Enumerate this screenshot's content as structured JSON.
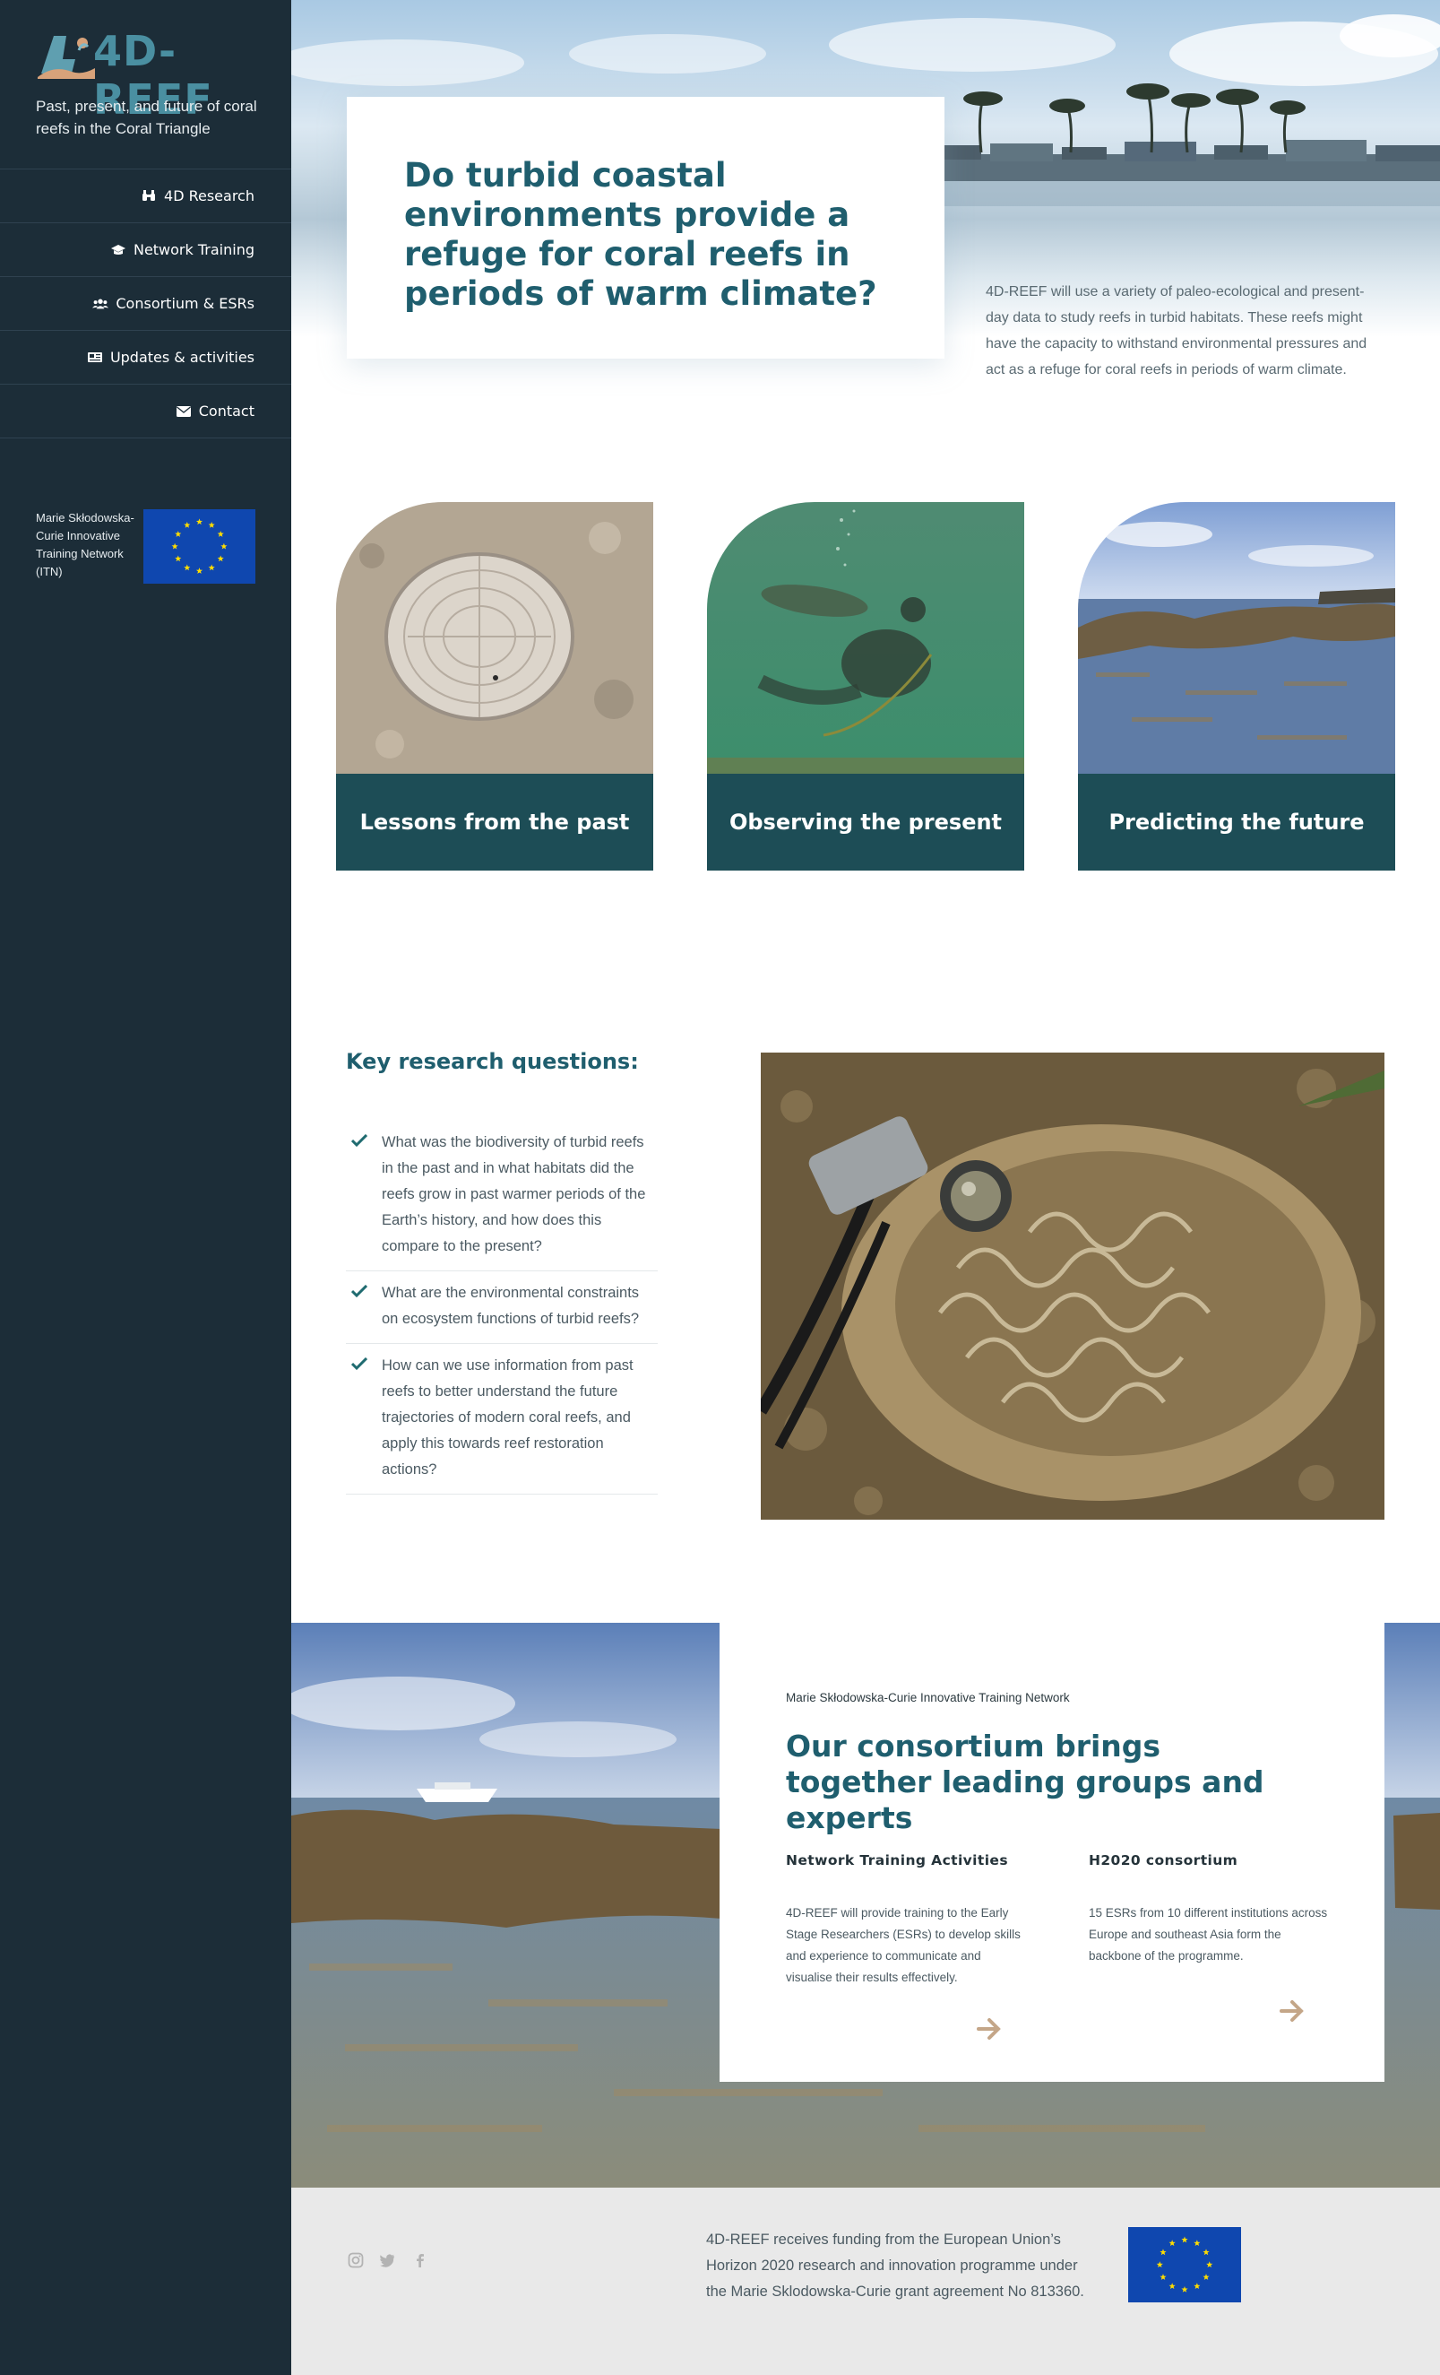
{
  "sidebar": {
    "logo_text": "4D-REEF",
    "tagline": "Past, present, and future of coral reefs in the Coral Triangle",
    "nav": [
      {
        "label": "4D Research",
        "icon": "binoculars-icon"
      },
      {
        "label": "Network Training",
        "icon": "graduation-cap-icon"
      },
      {
        "label": "Consortium & ESRs",
        "icon": "users-icon"
      },
      {
        "label": "Updates & activities",
        "icon": "newspaper-icon"
      },
      {
        "label": "Contact",
        "icon": "envelope-icon"
      }
    ],
    "msca_text": "Marie Skłodowska-Curie Innovative Training Network (ITN)"
  },
  "hero": {
    "title": "Do turbid coastal environments provide a refuge for coral reefs in periods of warm climate?",
    "description": "4D-REEF will use a variety of paleo-ecological and present-day data to study reefs in turbid habitats. These reefs might have the capacity to withstand environmental pressures and act as a refuge for coral reefs in periods of warm climate."
  },
  "features": [
    {
      "label": "Lessons from the past"
    },
    {
      "label": "Observing the present"
    },
    {
      "label": "Predicting the future"
    }
  ],
  "research": {
    "title": "Key research questions:",
    "questions": [
      "What was the biodiversity of turbid reefs in the past and in what habitats did the reefs grow in past warmer periods of the Earth’s history, and how does this compare to the present?",
      "What are the environmental constraints on ecosystem functions of turbid reefs?",
      "How can we use information from past reefs to better understand the future trajectories of modern coral reefs, and apply this towards reef restoration actions?"
    ]
  },
  "consortium": {
    "kicker": "Marie Skłodowska-Curie Innovative Training Network",
    "title": "Our consortium brings together leading groups and experts",
    "columns": [
      {
        "heading": "Network Training Activities",
        "text": "4D-REEF will provide training to the Early Stage Researchers (ESRs) to develop skills and experience to communicate and visualise their results effectively."
      },
      {
        "heading": "H2020 consortium",
        "text": "15 ESRs from 10 different institutions across Europe and southeast Asia form the backbone of the programme."
      }
    ]
  },
  "footer": {
    "funding_text": "4D-REEF receives funding from the European Union’s Horizon 2020 research and innovation programme under the Marie Sklodowska-Curie grant agreement No 813360.",
    "social": [
      "instagram-icon",
      "twitter-icon",
      "facebook-icon"
    ]
  },
  "colors": {
    "sidebar_bg": "#1c2d38",
    "heading_teal": "#1f5e6e",
    "band_teal": "#1d4d56",
    "arrow_tan": "#c4a688",
    "eu_blue": "#0f47af",
    "eu_star": "#ffdd00",
    "footer_bg": "#e9e9e9"
  }
}
